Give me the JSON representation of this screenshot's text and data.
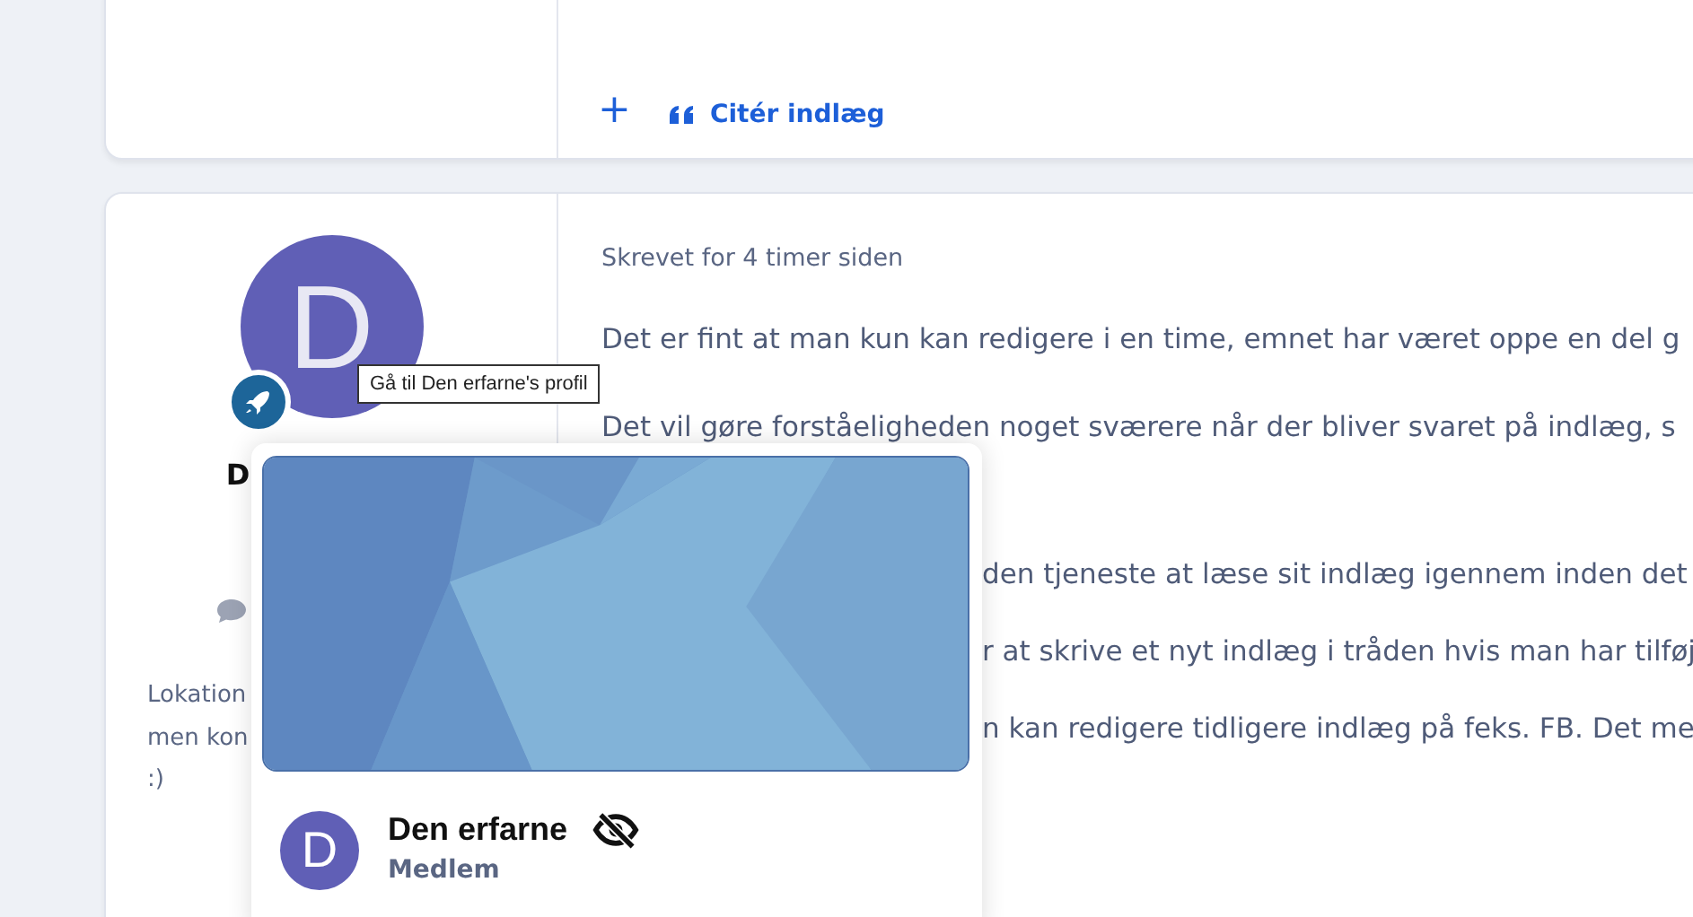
{
  "previous_post": {
    "actions": [
      {
        "kind": "add",
        "label": "+"
      },
      {
        "kind": "quote",
        "label": "Citér indlæg"
      }
    ]
  },
  "post": {
    "author": {
      "initial": "D",
      "name_visible": "D",
      "location_lines": [
        "Lokation",
        "men kon",
        ":)"
      ]
    },
    "meta": "Skrevet for 4 timer siden",
    "paragraphs": [
      {
        "kind": "full",
        "text": "Det er fint at man kun kan redigere i en time, emnet har været oppe en del g"
      },
      {
        "kind": "full",
        "text": "Det vil gøre forståeligheden noget sværere når der bliver svaret på indlæg, s"
      },
      {
        "kind": "clipped",
        "text": "den tjeneste at læse sit indlæg igennem inden det"
      },
      {
        "kind": "clipped",
        "text": "r at skrive et nyt indlæg i tråden hvis man har tilføj"
      },
      {
        "kind": "clipped",
        "text": "n kan redigere tidligere indlæg på feks. FB. Det me"
      }
    ]
  },
  "tooltip": "Gå til Den erfarne's profil",
  "profile_card": {
    "initial": "D",
    "name": "Den erfarne",
    "role": "Medlem"
  }
}
